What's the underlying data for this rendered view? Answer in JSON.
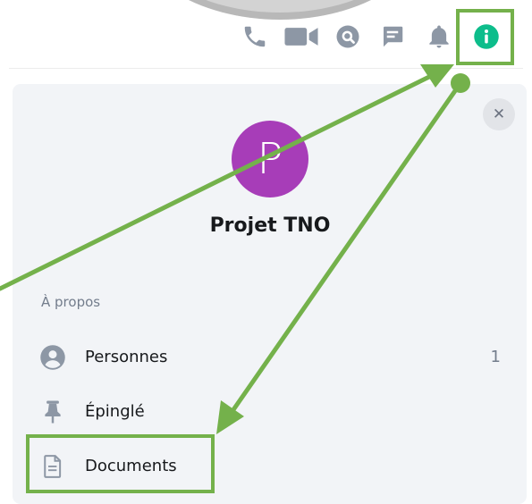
{
  "toolbar": {
    "icons": [
      "phone-icon",
      "video-icon",
      "search-icon",
      "threads-icon",
      "bell-icon",
      "info-icon"
    ]
  },
  "panel": {
    "close_icon": "✕",
    "avatar_letter": "P",
    "title": "Projet TNO",
    "section_label": "À propos",
    "items": [
      {
        "label": "Personnes",
        "icon": "person-icon",
        "count": "1"
      },
      {
        "label": "Épinglé",
        "icon": "pin-icon"
      },
      {
        "label": "Documents",
        "icon": "file-icon"
      }
    ]
  },
  "colors": {
    "annotation_green": "#74b14b",
    "avatar_purple": "#a73db8",
    "info_green": "#0dbd8b",
    "icon_gray": "#8d97a5",
    "panel_bg": "#f2f4f7"
  }
}
